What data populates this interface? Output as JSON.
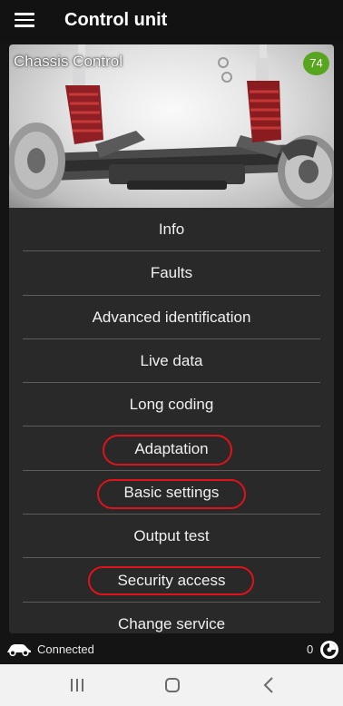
{
  "appbar": {
    "title": "Control unit",
    "menu_icon": "hamburger-menu-icon"
  },
  "unit": {
    "name": "Chassis Control",
    "badge": "74",
    "badge_color": "#58a61f"
  },
  "menu": [
    {
      "label": "Info",
      "highlighted": false
    },
    {
      "label": "Faults",
      "highlighted": false
    },
    {
      "label": "Advanced identification",
      "highlighted": false
    },
    {
      "label": "Live data",
      "highlighted": false
    },
    {
      "label": "Long coding",
      "highlighted": false
    },
    {
      "label": "Adaptation",
      "highlighted": true
    },
    {
      "label": "Basic settings",
      "highlighted": true
    },
    {
      "label": "Output test",
      "highlighted": false
    },
    {
      "label": "Security access",
      "highlighted": true
    },
    {
      "label": "Change service",
      "highlighted": false
    }
  ],
  "highlight_color": "#e0121a",
  "status": {
    "text": "Connected",
    "count": "0",
    "car_icon": "car-connected-icon",
    "net_icon": "connection-indicator-icon"
  },
  "navbar": {
    "recents_icon": "recents-icon",
    "home_icon": "home-icon",
    "back_icon": "back-icon"
  }
}
